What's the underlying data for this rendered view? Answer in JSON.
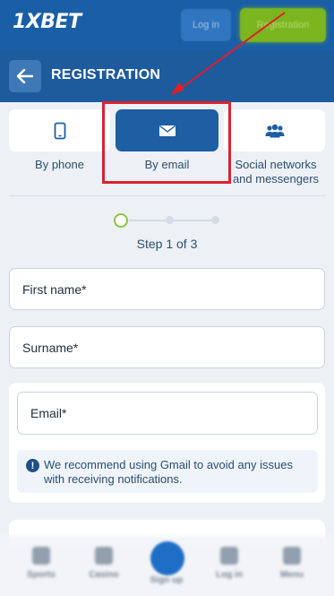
{
  "topbar": {
    "logo": "1XBET",
    "login_label": "Log in",
    "register_label": "Registration",
    "colors": {
      "bar": "#1a5fa6",
      "register": "#7bb51f"
    }
  },
  "header": {
    "title": "REGISTRATION"
  },
  "tabs": [
    {
      "label": "By phone",
      "icon": "phone-icon",
      "active": false
    },
    {
      "label": "By email",
      "icon": "envelope-icon",
      "active": true
    },
    {
      "label": "Social networks and messengers",
      "icon": "users-icon",
      "active": false
    }
  ],
  "steps": {
    "current": 1,
    "total": 3,
    "text": "Step 1 of 3"
  },
  "form": {
    "first_name_placeholder": "First name*",
    "surname_placeholder": "Surname*",
    "email_placeholder": "Email*",
    "info_text": "We recommend using Gmail to avoid any issues with receiving notifications."
  },
  "bottom_nav": {
    "items": [
      {
        "label": "Sports",
        "icon": "trophy-icon"
      },
      {
        "label": "Casino",
        "icon": "casino-icon"
      },
      {
        "label": "Sign up",
        "icon": "signup-icon"
      },
      {
        "label": "Log in",
        "icon": "user-icon"
      },
      {
        "label": "Menu",
        "icon": "menu-icon"
      }
    ]
  },
  "accent_color": "#1e5ea3",
  "highlight_color": "#d9232e"
}
